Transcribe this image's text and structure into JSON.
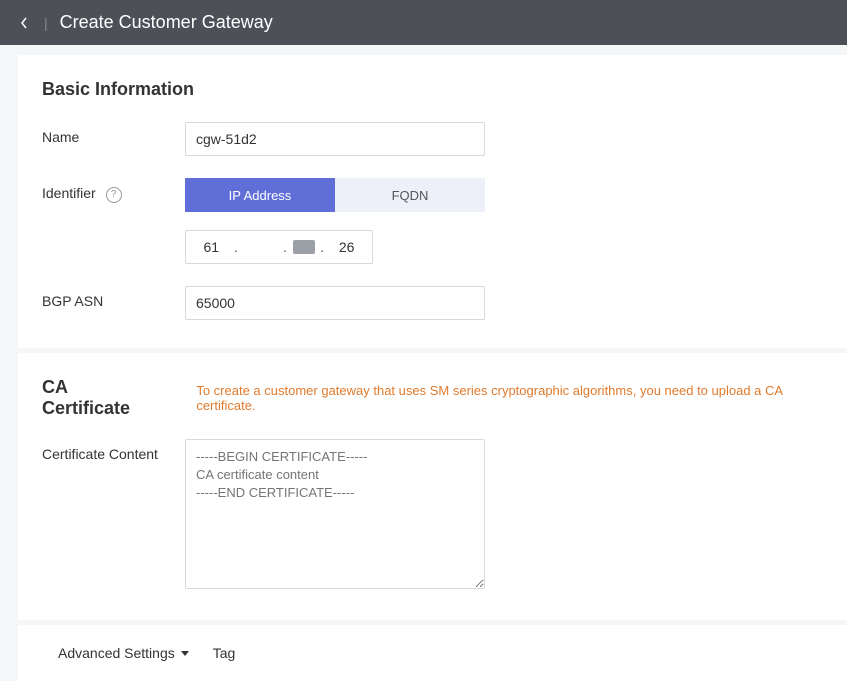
{
  "header": {
    "title": "Create Customer Gateway"
  },
  "basic": {
    "section_title": "Basic Information",
    "name_label": "Name",
    "name_value": "cgw-51d2",
    "identifier_label": "Identifier",
    "identifier_options": {
      "ip": "IP Address",
      "fqdn": "FQDN"
    },
    "ip_octets": {
      "a": "61",
      "b": "",
      "c": "",
      "d": "26"
    },
    "bgp_label": "BGP ASN",
    "bgp_value": "65000"
  },
  "cert": {
    "section_title": "CA Certificate",
    "note": "To create a customer gateway that uses SM series cryptographic algorithms, you need to upload a CA certificate.",
    "content_label": "Certificate Content",
    "placeholder": "-----BEGIN CERTIFICATE-----\nCA certificate content\n-----END CERTIFICATE-----"
  },
  "adv": {
    "label": "Advanced Settings",
    "tag": "Tag"
  }
}
